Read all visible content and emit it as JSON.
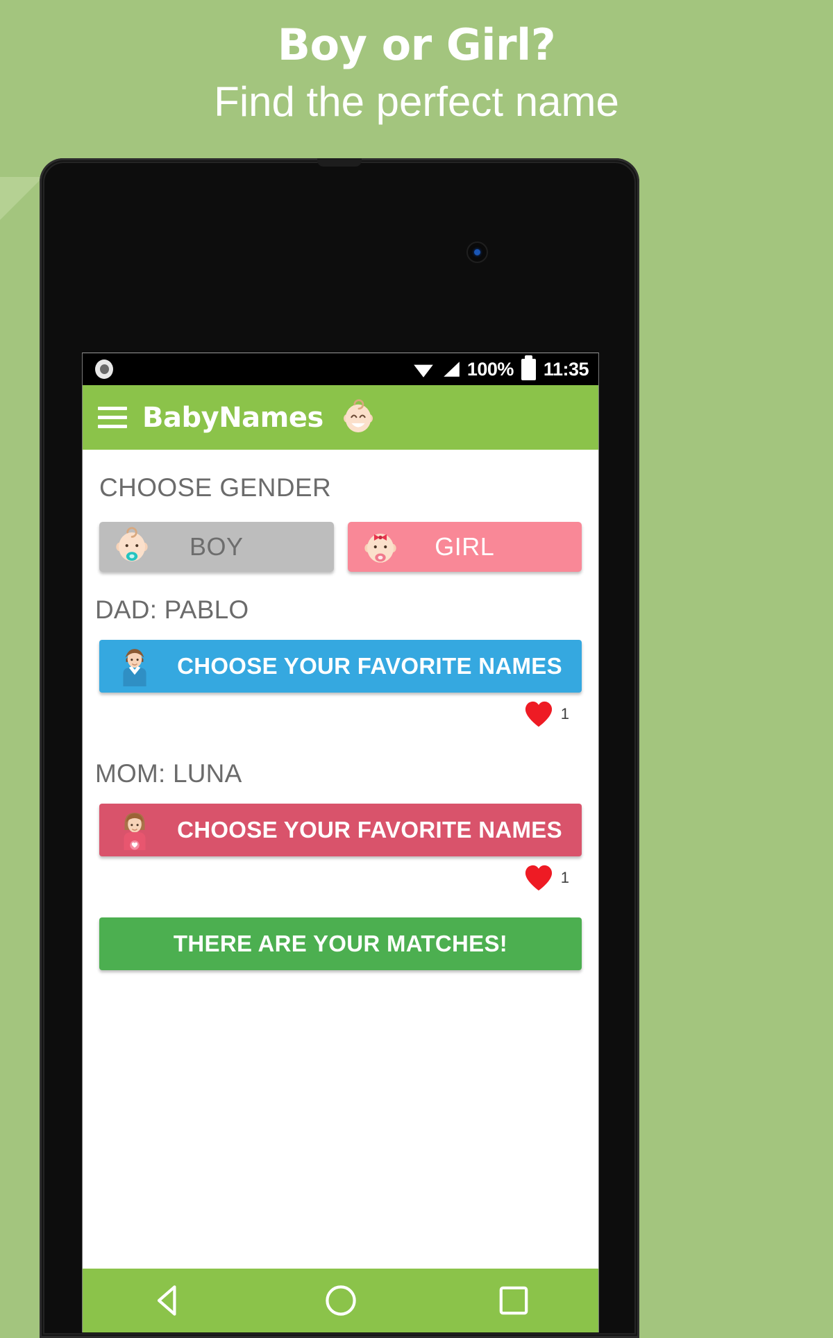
{
  "promo": {
    "title": "Boy or Girl?",
    "subtitle": "Find the perfect name",
    "background_color": "#a3c57e",
    "text_color": "#ffffff"
  },
  "statusbar": {
    "battery_percent": "100%",
    "time": "11:35",
    "icons": [
      "record-circle-icon",
      "wifi-icon",
      "signal-icon",
      "battery-icon"
    ]
  },
  "appbar": {
    "menu_icon": "hamburger-menu-icon",
    "title": "BabyNames",
    "logo_icon": "baby-face-icon",
    "background_color": "#8bc34a"
  },
  "content": {
    "gender_section_label": "CHOOSE GENDER",
    "gender_options": [
      {
        "label": "BOY",
        "icon": "baby-boy-face-icon",
        "color": "#bdbdbd",
        "selected": false
      },
      {
        "label": "GIRL",
        "icon": "baby-girl-face-icon",
        "color": "#f98897",
        "selected": true
      }
    ],
    "dad": {
      "label": "DAD: PABLO",
      "button_label": "CHOOSE YOUR FAVORITE NAMES",
      "button_icon": "man-avatar-icon",
      "button_color": "#35a8e0",
      "favorites_count": "1",
      "favorites_icon": "heart-icon"
    },
    "mom": {
      "label": "MOM: LUNA",
      "button_label": "CHOOSE YOUR FAVORITE NAMES",
      "button_icon": "woman-avatar-icon",
      "button_color": "#d9536b",
      "favorites_count": "1",
      "favorites_icon": "heart-icon"
    },
    "matches_button": {
      "label": "THERE ARE YOUR MATCHES!",
      "color": "#4caf50"
    }
  },
  "navbar": {
    "back_icon": "back-triangle-icon",
    "home_icon": "home-circle-icon",
    "recents_icon": "recents-square-icon",
    "background_color": "#8bc34a"
  }
}
